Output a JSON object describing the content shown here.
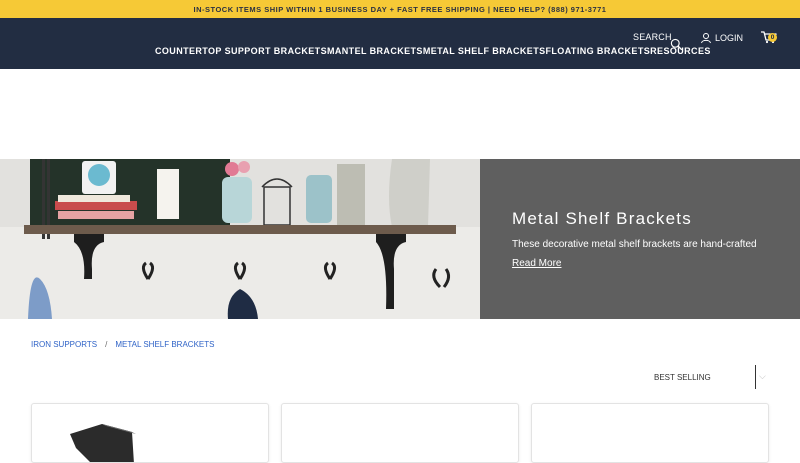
{
  "promo": "IN-STOCK ITEMS SHIP WITHIN 1 BUSINESS DAY + FAST FREE SHIPPING | NEED HELP? (888) 971-3771",
  "header": {
    "search_label": "SEARCH",
    "login_label": "LOGIN",
    "cart_count": "0",
    "nav": [
      "COUNTERTOP SUPPORT BRACKETS",
      "MANTEL BRACKETS",
      "METAL SHELF BRACKETS",
      "FLOATING BRACKETS",
      "RESOURCES"
    ]
  },
  "hero": {
    "title": "Metal Shelf Brackets",
    "text": "These decorative metal shelf brackets are hand-crafted",
    "link": "Read More"
  },
  "breadcrumb": [
    "IRON SUPPORTS",
    "/",
    "METAL SHELF BRACKETS"
  ],
  "sort": {
    "selected": "BEST SELLING"
  },
  "colors": {
    "promo_bg": "#f6c936",
    "nav_bg": "#222d42",
    "hero_panel_bg": "#5f5f5f",
    "link": "#2f63c7"
  },
  "icons": [
    "search-icon",
    "user-icon",
    "cart-icon",
    "chevron-down-icon"
  ]
}
